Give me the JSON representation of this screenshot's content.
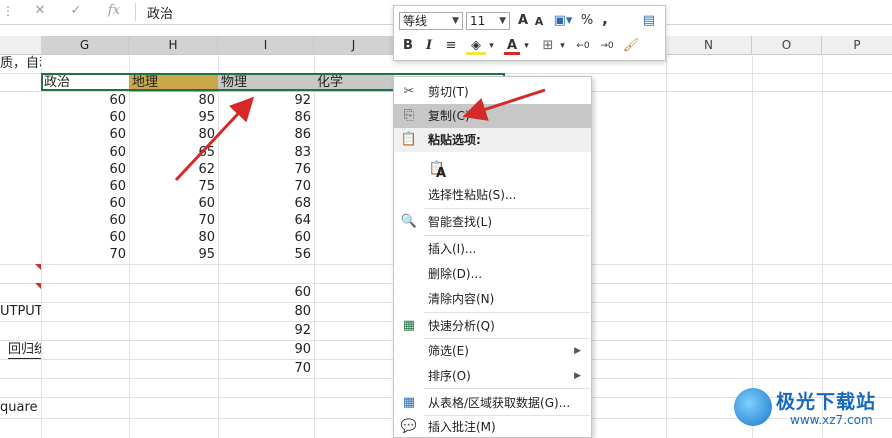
{
  "formula_bar": {
    "more": "⋮",
    "cancel_icon": "close-icon",
    "cancel_glyph": "✕",
    "enter_glyph": "✓",
    "fx_label": "fx",
    "value": "政治"
  },
  "columns": [
    "G",
    "H",
    "I",
    "J",
    "N",
    "O",
    "P"
  ],
  "left_fragments": {
    "row1": "质，自动",
    "output": "UTPUT",
    "regress": "回归统",
    "square": "quare"
  },
  "headers": {
    "g": "政治",
    "h": "地理",
    "i": "物理",
    "j": "化学"
  },
  "data_rows": [
    {
      "g": "60",
      "h": "80",
      "i": "92"
    },
    {
      "g": "60",
      "h": "95",
      "i": "86"
    },
    {
      "g": "60",
      "h": "80",
      "i": "86"
    },
    {
      "g": "60",
      "h": "65",
      "i": "83"
    },
    {
      "g": "60",
      "h": "62",
      "i": "76"
    },
    {
      "g": "60",
      "h": "75",
      "i": "70"
    },
    {
      "g": "60",
      "h": "60",
      "i": "68"
    },
    {
      "g": "60",
      "h": "70",
      "i": "64"
    },
    {
      "g": "60",
      "h": "80",
      "i": "60"
    },
    {
      "g": "70",
      "h": "95",
      "i": "56"
    }
  ],
  "lower_i": [
    "60",
    "80",
    "92",
    "90",
    "70"
  ],
  "mini_toolbar": {
    "font": "等线",
    "size": "11",
    "grow": "A",
    "shrink": "A",
    "percent": "%",
    "comma": ",",
    "bold": "B",
    "italic": "I",
    "font_color_letter": "A",
    "dec_inc": "←0",
    "dec_dec": "→0"
  },
  "context_menu": {
    "items": [
      {
        "label": "剪切(T)",
        "icon": "scissors-icon",
        "glyph": "✂"
      },
      {
        "label": "复制(C)",
        "icon": "copy-icon",
        "glyph": "⎘"
      },
      {
        "label": "粘贴选项:",
        "icon": "paste-icon",
        "glyph": "📋"
      },
      {
        "label": "A",
        "icon": "paste-clipboard-icon",
        "glyph": "📋"
      },
      {
        "label": "选择性粘贴(S)...",
        "icon": "",
        "glyph": ""
      },
      {
        "label": "智能查找(L)",
        "icon": "smart-lookup-icon",
        "glyph": "🔍"
      },
      {
        "label": "插入(I)...",
        "icon": "",
        "glyph": ""
      },
      {
        "label": "删除(D)...",
        "icon": "",
        "glyph": ""
      },
      {
        "label": "清除内容(N)",
        "icon": "",
        "glyph": ""
      },
      {
        "label": "快速分析(Q)",
        "icon": "quick-analysis-icon",
        "glyph": "▦"
      },
      {
        "label": "筛选(E)",
        "icon": "",
        "glyph": ""
      },
      {
        "label": "排序(O)",
        "icon": "",
        "glyph": ""
      },
      {
        "label": "从表格/区域获取数据(G)...",
        "icon": "table-icon",
        "glyph": "▦"
      },
      {
        "label": "插入批注(M)",
        "icon": "comment-icon",
        "glyph": "💬"
      }
    ],
    "submenu_glyph": "▶"
  },
  "colors": {
    "selection_border": "#217346",
    "highlight_gold": "#c9a84a",
    "highlight_gray": "#c8c8c8",
    "arrow_red": "#d42a2a",
    "menu_highlight": "#c7c7c7"
  },
  "watermark": {
    "title": "极光下载站",
    "url": "www.xz7.com"
  }
}
